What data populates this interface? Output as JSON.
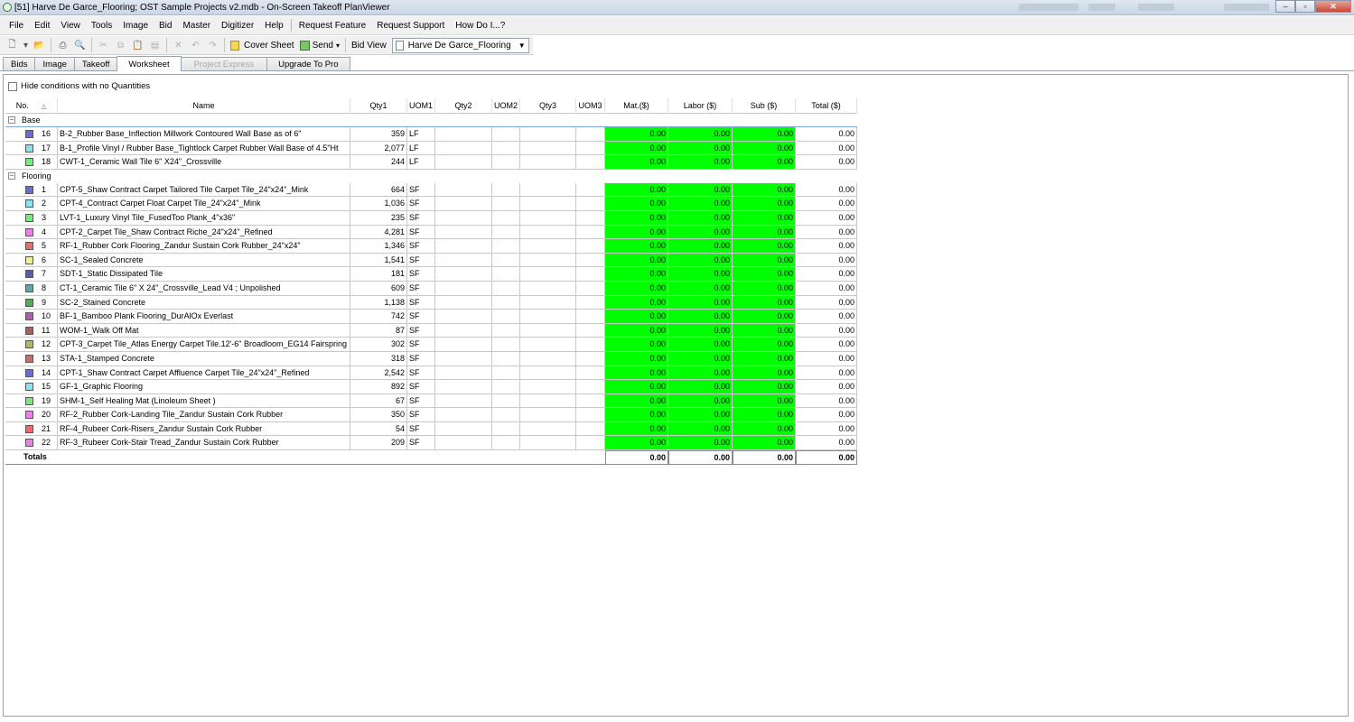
{
  "window": {
    "title": "[51] Harve De Garce_Flooring; OST Sample Projects v2.mdb - On-Screen Takeoff PlanViewer"
  },
  "menu": {
    "items": [
      "File",
      "Edit",
      "View",
      "Tools",
      "Image",
      "Bid",
      "Master",
      "Digitizer",
      "Help"
    ],
    "extra": [
      "Request Feature",
      "Request Support",
      "How Do I...?"
    ]
  },
  "toolbar": {
    "cover_sheet": "Cover Sheet",
    "send": "Send",
    "bid_view_label": "Bid View",
    "bid_view_value": "Harve De Garce_Flooring"
  },
  "tabs": [
    {
      "label": "Bids",
      "state": "normal"
    },
    {
      "label": "Image",
      "state": "normal"
    },
    {
      "label": "Takeoff",
      "state": "normal"
    },
    {
      "label": "Worksheet",
      "state": "active"
    },
    {
      "label": "Project Express",
      "state": "disabled"
    },
    {
      "label": "Upgrade To Pro",
      "state": "normal"
    }
  ],
  "worksheet": {
    "hide_conditions_label": "Hide conditions with no Quantities",
    "headers": {
      "no": "No.",
      "name": "Name",
      "qty1": "Qty1",
      "uom1": "UOM1",
      "qty2": "Qty2",
      "uom2": "UOM2",
      "qty3": "Qty3",
      "uom3": "UOM3",
      "mat": "Mat.($)",
      "labor": "Labor ($)",
      "sub": "Sub ($)",
      "total": "Total ($)"
    },
    "groups": [
      {
        "label": "Base",
        "rows": [
          {
            "no": "16",
            "color": "#6b6bdc",
            "name": "B-2_Rubber Base_Inflection Millwork Contoured Wall Base as of 6\"",
            "qty1": "359",
            "uom1": "LF",
            "mat": "0.00",
            "labor": "0.00",
            "sub": "0.00",
            "total": "0.00"
          },
          {
            "no": "17",
            "color": "#7fe8f0",
            "name": "B-1_Profile Vinyl / Rubber Base_Tightlock Carpet Rubber Wall Base of 4.5\"Ht",
            "qty1": "2,077",
            "uom1": "LF",
            "mat": "0.00",
            "labor": "0.00",
            "sub": "0.00",
            "total": "0.00"
          },
          {
            "no": "18",
            "color": "#78ec78",
            "name": "CWT-1_Ceramic Wall Tile 6\" X24\"_Crossville",
            "qty1": "244",
            "uom1": "LF",
            "mat": "0.00",
            "labor": "0.00",
            "sub": "0.00",
            "total": "0.00"
          }
        ]
      },
      {
        "label": "Flooring",
        "rows": [
          {
            "no": "1",
            "color": "#6b6bdc",
            "name": "CPT-5_Shaw Contract Carpet Tailored Tile Carpet Tile_24\"x24\"_Mink",
            "qty1": "664",
            "uom1": "SF",
            "mat": "0.00",
            "labor": "0.00",
            "sub": "0.00",
            "total": "0.00"
          },
          {
            "no": "2",
            "color": "#7fe8f0",
            "name": "CPT-4_Contract Carpet Float Carpet Tile_24\"x24\"_Mink",
            "qty1": "1,036",
            "uom1": "SF",
            "mat": "0.00",
            "labor": "0.00",
            "sub": "0.00",
            "total": "0.00"
          },
          {
            "no": "3",
            "color": "#78ec78",
            "name": "LVT-1_Luxury Vinyl Tile_FusedToo Plank_4\"x36\"",
            "qty1": "235",
            "uom1": "SF",
            "mat": "0.00",
            "labor": "0.00",
            "sub": "0.00",
            "total": "0.00"
          },
          {
            "no": "4",
            "color": "#f07cf0",
            "name": "CPT-2_Carpet Tile_Shaw Contract Riche_24\"x24\"_Refined",
            "qty1": "4,281",
            "uom1": "SF",
            "mat": "0.00",
            "labor": "0.00",
            "sub": "0.00",
            "total": "0.00"
          },
          {
            "no": "5",
            "color": "#f06a6a",
            "name": "RF-1_Rubber Cork Flooring_Zandur Sustain Cork Rubber_24\"x24\"",
            "qty1": "1,346",
            "uom1": "SF",
            "mat": "0.00",
            "labor": "0.00",
            "sub": "0.00",
            "total": "0.00"
          },
          {
            "no": "6",
            "color": "#f4f47a",
            "name": "SC-1_Sealed Concrete",
            "qty1": "1,541",
            "uom1": "SF",
            "mat": "0.00",
            "labor": "0.00",
            "sub": "0.00",
            "total": "0.00"
          },
          {
            "no": "7",
            "color": "#5a5aa8",
            "name": "SDT-1_Static Dissipated Tile",
            "qty1": "181",
            "uom1": "SF",
            "mat": "0.00",
            "labor": "0.00",
            "sub": "0.00",
            "total": "0.00"
          },
          {
            "no": "8",
            "color": "#5aa8a8",
            "name": "CT-1_Ceramic Tile 6\" X 24\"_Crossville_Lead V4 ; Unpolished",
            "qty1": "609",
            "uom1": "SF",
            "mat": "0.00",
            "labor": "0.00",
            "sub": "0.00",
            "total": "0.00"
          },
          {
            "no": "9",
            "color": "#5aa85a",
            "name": "SC-2_Stained Concrete",
            "qty1": "1,138",
            "uom1": "SF",
            "mat": "0.00",
            "labor": "0.00",
            "sub": "0.00",
            "total": "0.00"
          },
          {
            "no": "10",
            "color": "#b45ab4",
            "name": "BF-1_Bamboo Plank Flooring_DurAlOx Everlast",
            "qty1": "742",
            "uom1": "SF",
            "mat": "0.00",
            "labor": "0.00",
            "sub": "0.00",
            "total": "0.00"
          },
          {
            "no": "11",
            "color": "#b45a5a",
            "name": "WOM-1_Walk Off Mat",
            "qty1": "87",
            "uom1": "SF",
            "mat": "0.00",
            "labor": "0.00",
            "sub": "0.00",
            "total": "0.00"
          },
          {
            "no": "12",
            "color": "#b4b46a",
            "name": "CPT-3_Carpet Tile_Atlas Energy Carpet Tile.12'-6\" Broadloom_EG14 Fairspring",
            "qty1": "302",
            "uom1": "SF",
            "mat": "0.00",
            "labor": "0.00",
            "sub": "0.00",
            "total": "0.00"
          },
          {
            "no": "13",
            "color": "#c86e6e",
            "name": "STA-1_Stamped Concrete",
            "qty1": "318",
            "uom1": "SF",
            "mat": "0.00",
            "labor": "0.00",
            "sub": "0.00",
            "total": "0.00"
          },
          {
            "no": "14",
            "color": "#6b6bdc",
            "name": "CPT-1_Shaw Contract Carpet Affluence Carpet Tile_24\"x24\"_Refined",
            "qty1": "2,542",
            "uom1": "SF",
            "mat": "0.00",
            "labor": "0.00",
            "sub": "0.00",
            "total": "0.00"
          },
          {
            "no": "15",
            "color": "#7fe8f0",
            "name": "GF-1_Graphic Flooring",
            "qty1": "892",
            "uom1": "SF",
            "mat": "0.00",
            "labor": "0.00",
            "sub": "0.00",
            "total": "0.00"
          },
          {
            "no": "19",
            "color": "#78ec78",
            "name": "SHM-1_Self Healing Mat (Linoleum Sheet )",
            "qty1": "67",
            "uom1": "SF",
            "mat": "0.00",
            "labor": "0.00",
            "sub": "0.00",
            "total": "0.00"
          },
          {
            "no": "20",
            "color": "#f07cf0",
            "name": "RF-2_Rubber Cork-Landing Tile_Zandur Sustain Cork Rubber",
            "qty1": "350",
            "uom1": "SF",
            "mat": "0.00",
            "labor": "0.00",
            "sub": "0.00",
            "total": "0.00"
          },
          {
            "no": "21",
            "color": "#f06a6a",
            "name": "RF-4_Rubeer Cork-Risers_Zandur Sustain Cork Rubber",
            "qty1": "54",
            "uom1": "SF",
            "mat": "0.00",
            "labor": "0.00",
            "sub": "0.00",
            "total": "0.00"
          },
          {
            "no": "22",
            "color": "#f07cf0",
            "name": "RF-3_Rubeer Cork-Stair Tread_Zandur Sustain Cork Rubber",
            "qty1": "209",
            "uom1": "SF",
            "mat": "0.00",
            "labor": "0.00",
            "sub": "0.00",
            "total": "0.00"
          }
        ]
      }
    ],
    "totals": {
      "label": "Totals",
      "mat": "0.00",
      "labor": "0.00",
      "sub": "0.00",
      "total": "0.00"
    },
    "cost_cell_color": "#00ff00"
  }
}
